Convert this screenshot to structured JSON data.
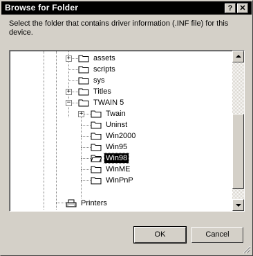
{
  "window": {
    "title": "Browse for Folder",
    "help_glyph": "?",
    "close_glyph": "✕"
  },
  "instruction": "Select the folder that contains driver information (.INF file) for this device.",
  "tree": {
    "items": [
      {
        "label": "assets",
        "expander": "+",
        "selected": false
      },
      {
        "label": "scripts",
        "expander": "",
        "selected": false
      },
      {
        "label": "sys",
        "expander": "",
        "selected": false
      },
      {
        "label": "Titles",
        "expander": "+",
        "selected": false
      },
      {
        "label": "TWAIN 5",
        "expander": "−",
        "selected": false
      },
      {
        "label": "Twain",
        "expander": "+",
        "selected": false
      },
      {
        "label": "Uninst",
        "expander": "",
        "selected": false
      },
      {
        "label": "Win2000",
        "expander": "",
        "selected": false
      },
      {
        "label": "Win95",
        "expander": "",
        "selected": false
      },
      {
        "label": "Win98",
        "expander": "",
        "selected": true
      },
      {
        "label": "WinME",
        "expander": "",
        "selected": false
      },
      {
        "label": "WinPnP",
        "expander": "",
        "selected": false
      },
      {
        "label": "Printers",
        "expander": "",
        "selected": false
      }
    ]
  },
  "buttons": {
    "ok": "OK",
    "cancel": "Cancel"
  },
  "colors": {
    "face": "#d4d0c8",
    "selection": "#000000",
    "titlebar": "#000000"
  }
}
